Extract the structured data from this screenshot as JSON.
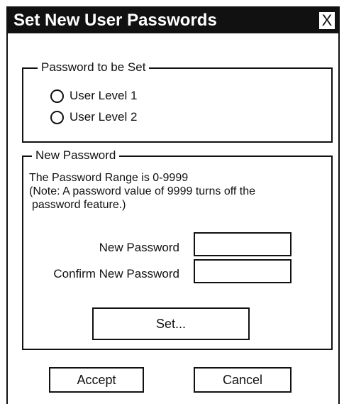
{
  "dialog": {
    "title": "Set New User Passwords",
    "close_label": "X"
  },
  "password_group": {
    "legend": "Password to be Set",
    "options": [
      "User Level 1",
      "User Level 2"
    ]
  },
  "new_password_group": {
    "legend": "New Password",
    "range_text": "The Password Range is 0-9999",
    "note_line1": "(Note: A password value of 9999 turns off the",
    "note_line2": "password feature.)",
    "new_password_label": "New Password",
    "new_password_value": "",
    "confirm_label": "Confirm New Password",
    "confirm_value": "",
    "set_button": "Set..."
  },
  "footer": {
    "accept": "Accept",
    "cancel": "Cancel"
  }
}
